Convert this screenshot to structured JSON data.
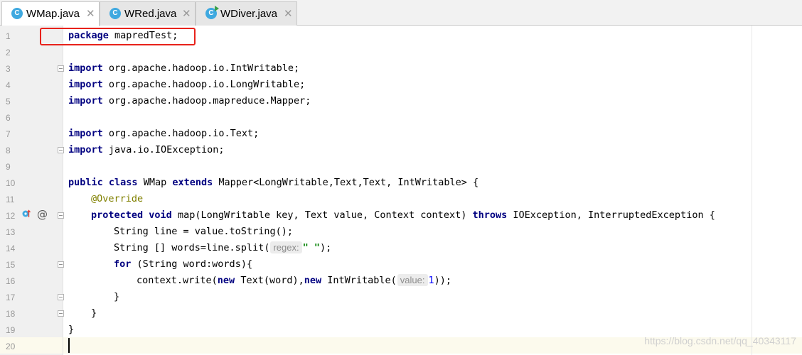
{
  "tabs": [
    {
      "name": "WMap.java",
      "icon": "java-class-icon",
      "badge": "C",
      "active": true
    },
    {
      "name": "WRed.java",
      "icon": "java-class-icon",
      "badge": "C",
      "active": false
    },
    {
      "name": "WDiver.java",
      "icon": "java-runnable-class-icon",
      "badge": "C",
      "active": false
    }
  ],
  "close_glyph": "✕",
  "line_numbers": [
    "1",
    "2",
    "3",
    "4",
    "5",
    "6",
    "7",
    "8",
    "9",
    "10",
    "11",
    "12",
    "13",
    "14",
    "15",
    "16",
    "17",
    "18",
    "19",
    "20"
  ],
  "code": {
    "l1": {
      "kw": "package",
      "rest": " mapredTest;"
    },
    "l3": {
      "kw": "import",
      "rest": " org.apache.hadoop.io.IntWritable;"
    },
    "l4": {
      "kw": "import",
      "rest": " org.apache.hadoop.io.LongWritable;"
    },
    "l5": {
      "kw": "import",
      "rest": " org.apache.hadoop.mapreduce.Mapper;"
    },
    "l7": {
      "kw": "import",
      "rest": " org.apache.hadoop.io.Text;"
    },
    "l8": {
      "kw": "import",
      "rest": " java.io.IOException;"
    },
    "l10": {
      "kw1": "public",
      "kw2": "class",
      "a": " WMap ",
      "kw3": "extends",
      "b": " Mapper<LongWritable,Text,Text, IntWritable> {"
    },
    "l11": {
      "ann": "@Override"
    },
    "l12": {
      "kw1": "protected",
      "kw2": "void",
      "a": " map(LongWritable key, Text value, Context context) ",
      "kw3": "throws",
      "b": " IOException, InterruptedException {"
    },
    "l13": {
      "text": "String line = value.toString();"
    },
    "l14": {
      "a": "String [] words=line.split(",
      "hint": "regex:",
      "str": "\" \"",
      "b": ");"
    },
    "l15": {
      "kw": "for",
      "rest": " (String word:words){"
    },
    "l16": {
      "a": "context.write(",
      "kw1": "new",
      "b": " Text(word),",
      "kw2": "new",
      "c": " IntWritable(",
      "hint": "value:",
      "num": "1",
      "d": "));"
    },
    "l17": {
      "text": "}"
    },
    "l18": {
      "text": "}"
    },
    "l19": {
      "text": "}"
    }
  },
  "gutter": {
    "override_icon": "overrides-method-icon",
    "annotation_icon": "at-sign-icon",
    "annotation_glyph": "@"
  },
  "watermark": "https://blog.csdn.net/qq_40343117",
  "colors": {
    "keyword": "#000080",
    "annotation": "#808000",
    "string": "#008000",
    "number": "#0000ff",
    "highlight_box": "#e8221b",
    "current_line": "#fcfaed"
  }
}
